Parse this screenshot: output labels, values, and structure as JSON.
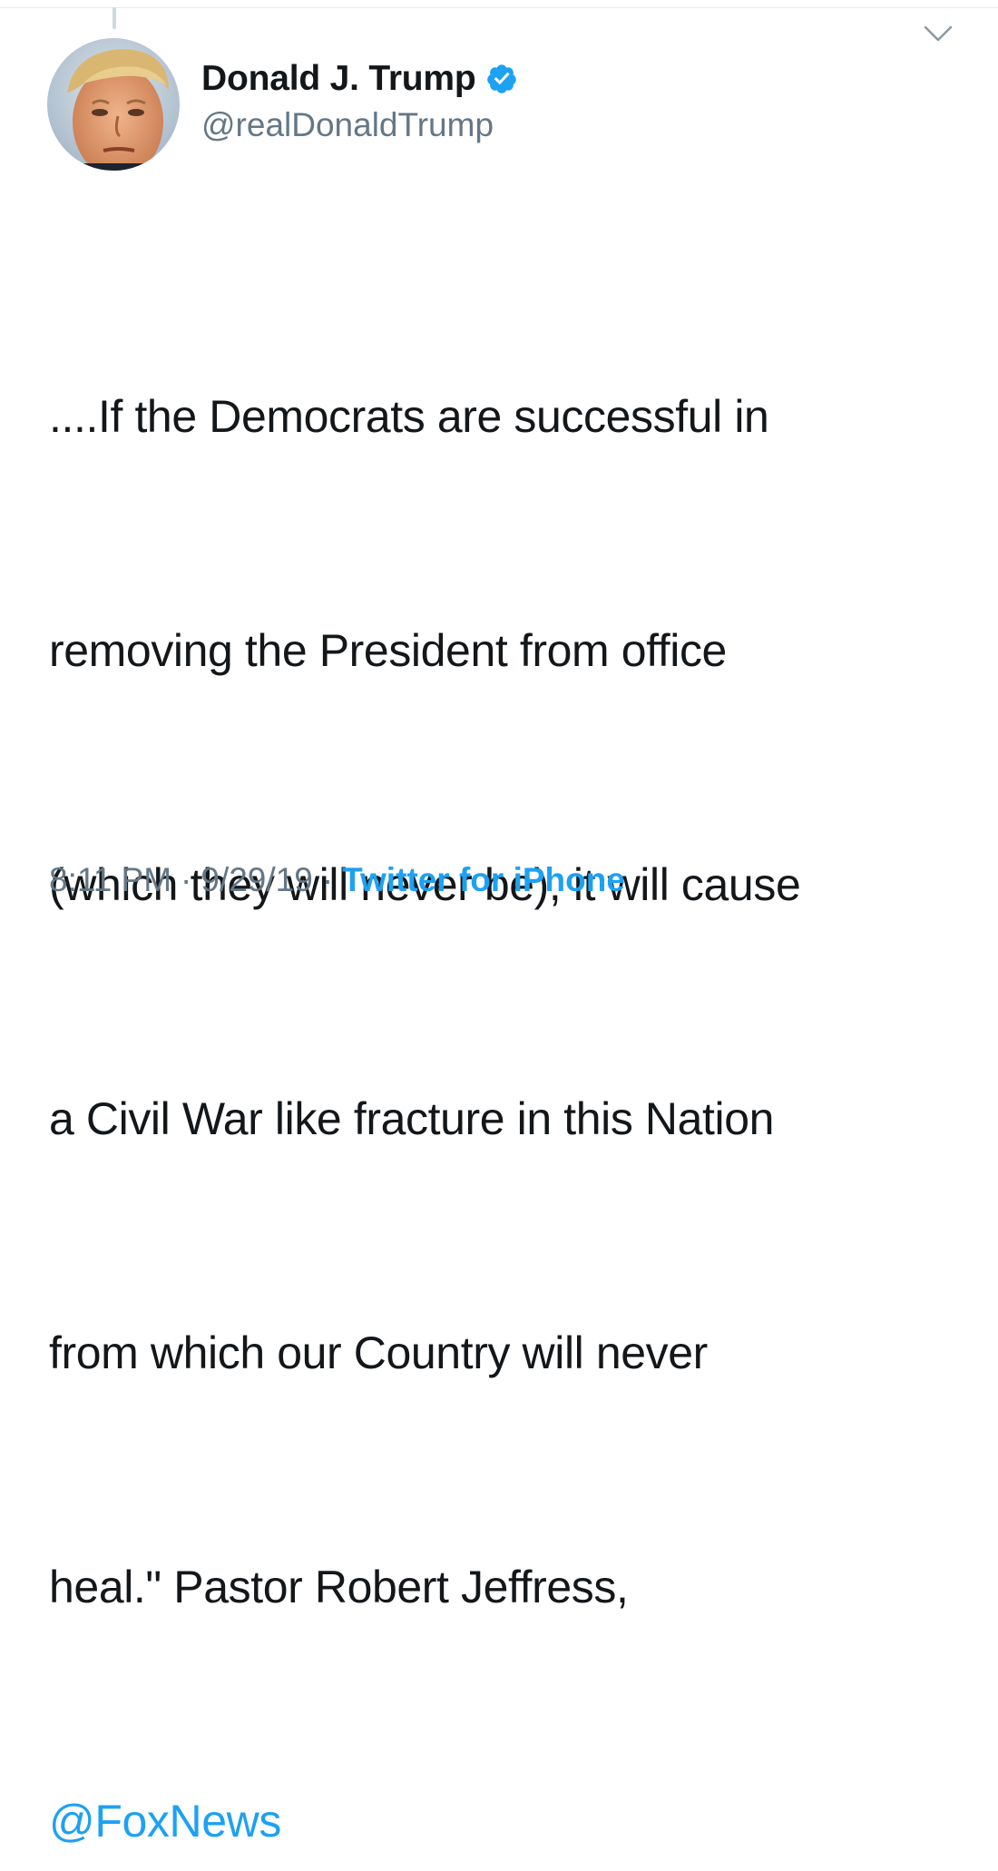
{
  "tweet": {
    "author": {
      "display_name": "Donald J. Trump",
      "handle": "@realDonaldTrump",
      "verified": true,
      "avatar_icon": "profile-photo-avatar"
    },
    "text_lines": [
      "....If the Democrats are successful in",
      "removing the President from office",
      "(which they will never be), it will cause",
      "a Civil War like fracture in this Nation",
      "from which our Country will never",
      "heal.\" Pastor Robert Jeffress,"
    ],
    "mention": "@FoxNews",
    "time": "8:11 PM",
    "date": "9/29/19",
    "separator": "·",
    "source": "Twitter for iPhone"
  },
  "icons": {
    "verified": "verified-badge-icon",
    "menu": "chevron-down-icon"
  },
  "colors": {
    "text": "#14171a",
    "secondary": "#657786",
    "link": "#1da1f2",
    "verified": "#1da1f2",
    "divider": "#e6ecf0"
  }
}
